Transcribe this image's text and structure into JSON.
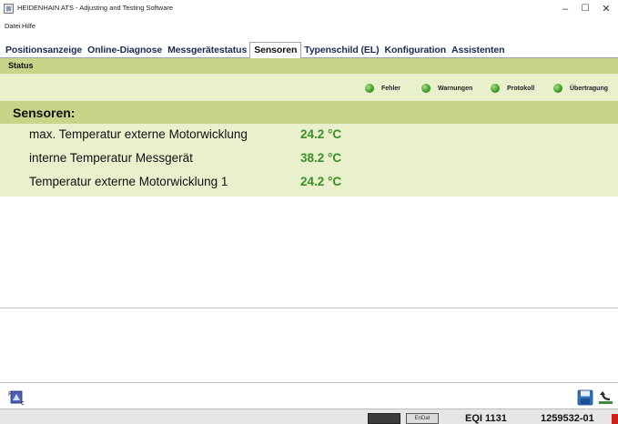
{
  "window": {
    "title": "HEIDENHAIN ATS - Adjusting and Testing Software"
  },
  "menu": {
    "items": [
      "Datei",
      "Hilfe"
    ]
  },
  "tabs": [
    {
      "label": "Positionsanzeige",
      "active": false
    },
    {
      "label": "Online-Diagnose",
      "active": false
    },
    {
      "label": "Messgerätestatus",
      "active": false
    },
    {
      "label": "Sensoren",
      "active": true
    },
    {
      "label": "Typenschild (EL)",
      "active": false
    },
    {
      "label": "Konfiguration",
      "active": false
    },
    {
      "label": "Assistenten",
      "active": false
    }
  ],
  "status": {
    "label": "Status",
    "indicators": [
      {
        "label": "Fehler",
        "color": "#44a02e"
      },
      {
        "label": "Warnungen",
        "color": "#44a02e"
      },
      {
        "label": "Protokoll",
        "color": "#44a02e"
      },
      {
        "label": "Übertragung",
        "color": "#44a02e"
      }
    ]
  },
  "sensors": {
    "title": "Sensoren:",
    "rows": [
      {
        "name": "max. Temperatur externe Motorwicklung",
        "value": "24.2 °C"
      },
      {
        "name": "interne Temperatur Messgerät",
        "value": "38.2 °C"
      },
      {
        "name": "Temperatur externe Motorwicklung 1",
        "value": "24.2 °C"
      }
    ]
  },
  "statusbar": {
    "encoder": "EQI 1131",
    "id": "1259532-01",
    "device_icon_2_text": "EnDat"
  },
  "colors": {
    "status_band": "#c6d587",
    "row_background": "#e8f0cc",
    "value_green": "#3c8e26",
    "alert_red": "#d0201a"
  }
}
